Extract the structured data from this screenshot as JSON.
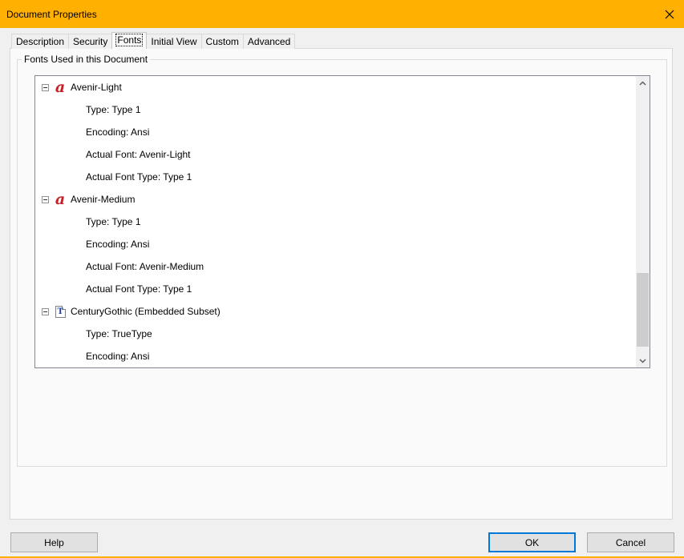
{
  "window": {
    "title": "Document Properties"
  },
  "tabs": [
    {
      "label": "Description"
    },
    {
      "label": "Security"
    },
    {
      "label": "Fonts"
    },
    {
      "label": "Initial View"
    },
    {
      "label": "Custom"
    },
    {
      "label": "Advanced"
    }
  ],
  "active_tab": "Fonts",
  "fonts_group": {
    "legend": "Fonts Used in this Document"
  },
  "font_tree": [
    {
      "name": "Avenir-Light",
      "icon": "type1-font-icon",
      "details": [
        "Type: Type 1",
        "Encoding: Ansi",
        "Actual Font: Avenir-Light",
        "Actual Font Type: Type 1"
      ]
    },
    {
      "name": "Avenir-Medium",
      "icon": "type1-font-icon",
      "details": [
        "Type: Type 1",
        "Encoding: Ansi",
        "Actual Font: Avenir-Medium",
        "Actual Font Type: Type 1"
      ]
    },
    {
      "name": "CenturyGothic (Embedded Subset)",
      "icon": "truetype-font-icon",
      "details": [
        "Type: TrueType",
        "Encoding: Ansi"
      ]
    }
  ],
  "buttons": {
    "help": "Help",
    "ok": "OK",
    "cancel": "Cancel"
  },
  "colors": {
    "titlebar": "#ffb000",
    "default_button_border": "#0078d7",
    "type1_icon": "#c62026"
  }
}
